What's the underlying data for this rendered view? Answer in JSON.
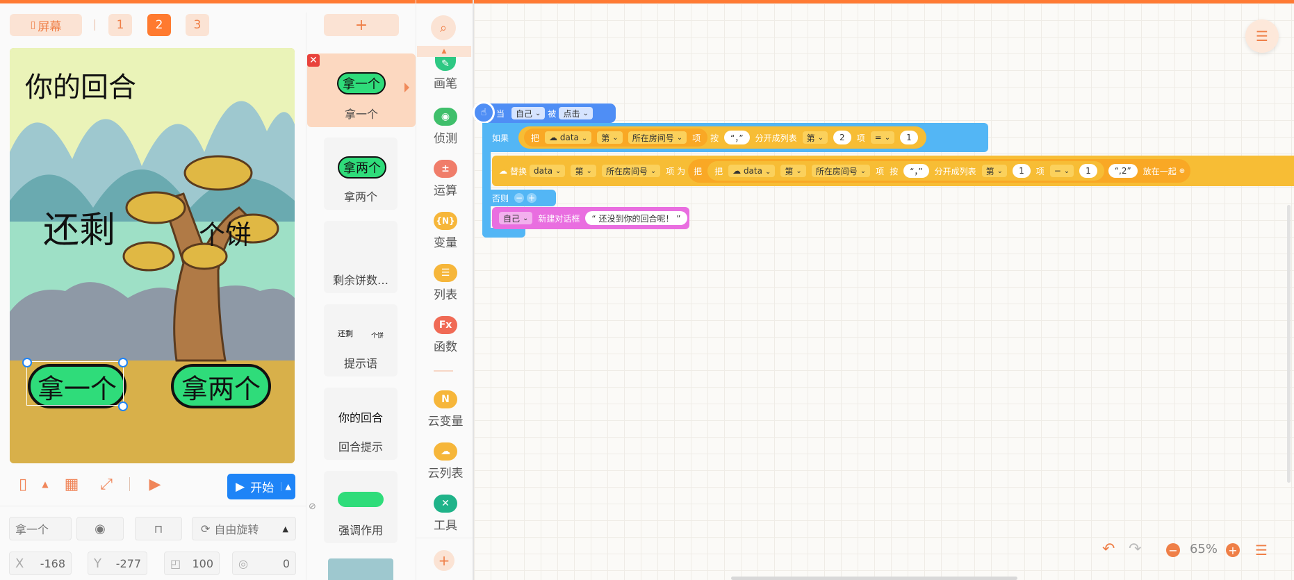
{
  "stage_header": {
    "screen_label": "屏幕",
    "pages": [
      "1",
      "2",
      "3"
    ],
    "active_page": "2"
  },
  "stage": {
    "title_text": "你的回合",
    "remain_text": "还剩",
    "cookie_text": "个饼",
    "btn_take_one": "拿一个",
    "btn_take_two": "拿两个"
  },
  "stage_toolbar": {
    "start_label": "开始"
  },
  "properties": {
    "name": "拿一个",
    "rotation_mode": "自由旋转",
    "x_label": "X",
    "x": "-168",
    "y_label": "Y",
    "y": "-277",
    "size": "100",
    "angle": "0"
  },
  "objects": {
    "add_label": "+",
    "items": [
      {
        "name": "拿一个",
        "preview": "拿一个"
      },
      {
        "name": "拿两个",
        "preview": "拿两个"
      },
      {
        "name": "剩余饼数…",
        "preview": ""
      },
      {
        "name": "提示语",
        "preview_a": "还剩",
        "preview_b": "个饼"
      },
      {
        "name": "回合提示",
        "preview": "你的回合"
      },
      {
        "name": "强调作用",
        "preview": ""
      }
    ]
  },
  "categories": [
    {
      "name": "画笔",
      "icon": "brush-icon",
      "color": "#2ec883"
    },
    {
      "name": "侦测",
      "icon": "detect-icon",
      "color": "#3fbf6b"
    },
    {
      "name": "运算",
      "icon": "operator-icon",
      "color": "#f07d6a"
    },
    {
      "name": "变量",
      "icon": "variable-icon",
      "color": "#f6b63a",
      "glyph": "{N}"
    },
    {
      "name": "列表",
      "icon": "list-icon",
      "color": "#f6b63a"
    },
    {
      "name": "函数",
      "icon": "function-icon",
      "color": "#f06a55",
      "glyph": "Fx"
    },
    {
      "name": "云变量",
      "icon": "cloud-variable-icon",
      "color": "#f6b63a",
      "glyph": "N"
    },
    {
      "name": "云列表",
      "icon": "cloud-list-icon",
      "color": "#f6b63a"
    },
    {
      "name": "工具",
      "icon": "tools-icon",
      "color": "#1fb389"
    }
  ],
  "code": {
    "event": {
      "when": "当",
      "target": "自己",
      "by": "被",
      "action": "点击"
    },
    "if_label": "如果",
    "cond": {
      "take": "把",
      "var": "data",
      "nth": "第",
      "room": "所在房间号",
      "item": "项",
      "by": "按",
      "sep": "“，”",
      "split": "分开成列表",
      "nth2": "第",
      "index": "2",
      "item2": "项",
      "op": "=",
      "value": "1"
    },
    "replace": {
      "replace": "替换",
      "var": "data",
      "nth": "第",
      "room": "所在房间号",
      "item_as": "项 为",
      "take": "把",
      "take2": "把",
      "var2": "data",
      "nth2": "第",
      "room2": "所在房间号",
      "item2": "项",
      "by": "按",
      "sep": "“，”",
      "split": "分开成列表",
      "nth3": "第",
      "index": "1",
      "item3": "项",
      "op": "−",
      "value": "1",
      "suffix": "“,2”",
      "join": "放在一起"
    },
    "else_label": "否则",
    "dialog": {
      "target": "自己",
      "action": "新建对话框",
      "text": "“ 还没到你的回合呢！ ”"
    }
  },
  "zoom": {
    "value": "65%"
  },
  "colors": {
    "accent": "#ff7a33",
    "event_blue": "#4f8ef5",
    "control_blue": "#53b6f5",
    "data_yellow": "#f7bd35",
    "dialog_pink": "#e96ee0"
  }
}
